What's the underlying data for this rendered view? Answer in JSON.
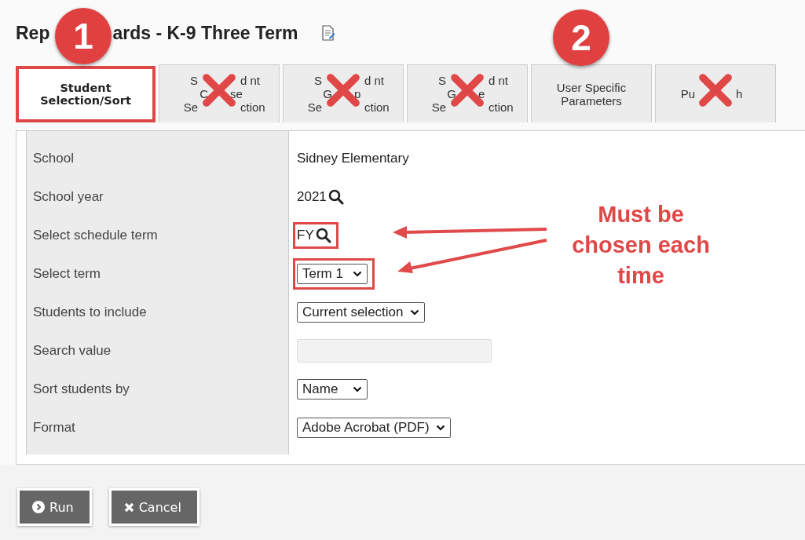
{
  "title_parts": [
    "Rep",
    "ards - K-9 Three Term"
  ],
  "tabs": [
    {
      "lines": [
        [
          "Student"
        ],
        [
          "Selection/Sort"
        ]
      ],
      "selected": true,
      "crossed": false,
      "highlighted": true
    },
    {
      "lines": [
        [
          "S",
          "d",
          "nt"
        ],
        [
          "C",
          "se"
        ],
        [
          "Se",
          "ction"
        ]
      ],
      "selected": false,
      "crossed": true,
      "highlighted": false
    },
    {
      "lines": [
        [
          "S",
          "d",
          "nt"
        ],
        [
          "G",
          "p"
        ],
        [
          "Se",
          "ction"
        ]
      ],
      "selected": false,
      "crossed": true,
      "highlighted": false
    },
    {
      "lines": [
        [
          "S",
          "d",
          "nt"
        ],
        [
          "G",
          "e"
        ],
        [
          "Se",
          "ction"
        ]
      ],
      "selected": false,
      "crossed": true,
      "highlighted": false
    },
    {
      "lines": [
        [
          "User Specific"
        ],
        [
          "Parameters"
        ]
      ],
      "selected": false,
      "crossed": false,
      "highlighted": false
    },
    {
      "lines": [
        [
          "Pu",
          "h"
        ]
      ],
      "selected": false,
      "crossed": true,
      "highlighted": false
    }
  ],
  "fields": [
    {
      "label": "School",
      "kind": "text",
      "value": "Sidney Elementary",
      "highlighted": false
    },
    {
      "label": "School year",
      "kind": "lookup",
      "value": "2021",
      "highlighted": false
    },
    {
      "label": "Select schedule term",
      "kind": "lookup",
      "value": "FY",
      "highlighted": true
    },
    {
      "label": "Select term",
      "kind": "select",
      "value": "Term 1",
      "highlighted": true
    },
    {
      "label": "Students to include",
      "kind": "select",
      "value": "Current selection",
      "highlighted": false
    },
    {
      "label": "Search value",
      "kind": "input",
      "highlighted": false
    },
    {
      "label": "Sort students by",
      "kind": "select",
      "value": "Name",
      "highlighted": false
    },
    {
      "label": "Format",
      "kind": "select",
      "value": "Adobe Acrobat (PDF)",
      "highlighted": false
    }
  ],
  "buttons": [
    {
      "label": "Run",
      "kind": "run"
    },
    {
      "label": "Cancel",
      "kind": "cancel"
    }
  ],
  "annotations": {
    "badges": [
      {
        "number": "1"
      },
      {
        "number": "2"
      }
    ],
    "callout": [
      "Must be",
      "chosen each",
      "time"
    ]
  }
}
